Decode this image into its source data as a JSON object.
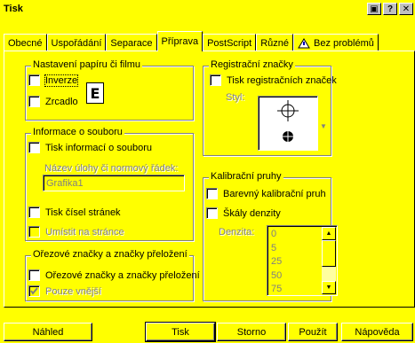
{
  "window": {
    "title": "Tisk",
    "buttons": [
      "▣",
      "?",
      "✕"
    ]
  },
  "tabs": [
    {
      "label": "Obecné"
    },
    {
      "label": "Uspořádání"
    },
    {
      "label": "Separace"
    },
    {
      "label": "Příprava"
    },
    {
      "label": "PostScript"
    },
    {
      "label": "Různé"
    },
    {
      "label": "Bez problémů"
    }
  ],
  "paper": {
    "legend": "Nastavení papíru či filmu",
    "inverze": "Inverze",
    "zrcadlo": "Zrcadlo",
    "icon_letter": "E"
  },
  "file_info": {
    "legend": "Informace o souboru",
    "print_info": "Tisk informací o souboru",
    "name_label": "Název úlohy či normový řádek:",
    "name_value": "Grafika1",
    "page_numbers": "Tisk čísel stránek",
    "inside_page": "Umístit na stránce"
  },
  "crop": {
    "legend": "Ořezové značky a značky přeložení",
    "crop_marks": "Ořezové značky a značky přeložení",
    "outside_only": "Pouze vnější"
  },
  "registration": {
    "legend": "Registrační značky",
    "print_marks": "Tisk registračních značek",
    "style_label": "Styl:"
  },
  "calibration": {
    "legend": "Kalibrační pruhy",
    "color_bar": "Barevný kalibrační pruh",
    "density": "Škály denzity",
    "density_label": "Denzita:",
    "density_values": [
      "0",
      "5",
      "25",
      "50",
      "75"
    ]
  },
  "footer": {
    "preview": "Náhled",
    "print": "Tisk",
    "cancel": "Storno",
    "apply": "Použít",
    "help": "Nápověda"
  }
}
